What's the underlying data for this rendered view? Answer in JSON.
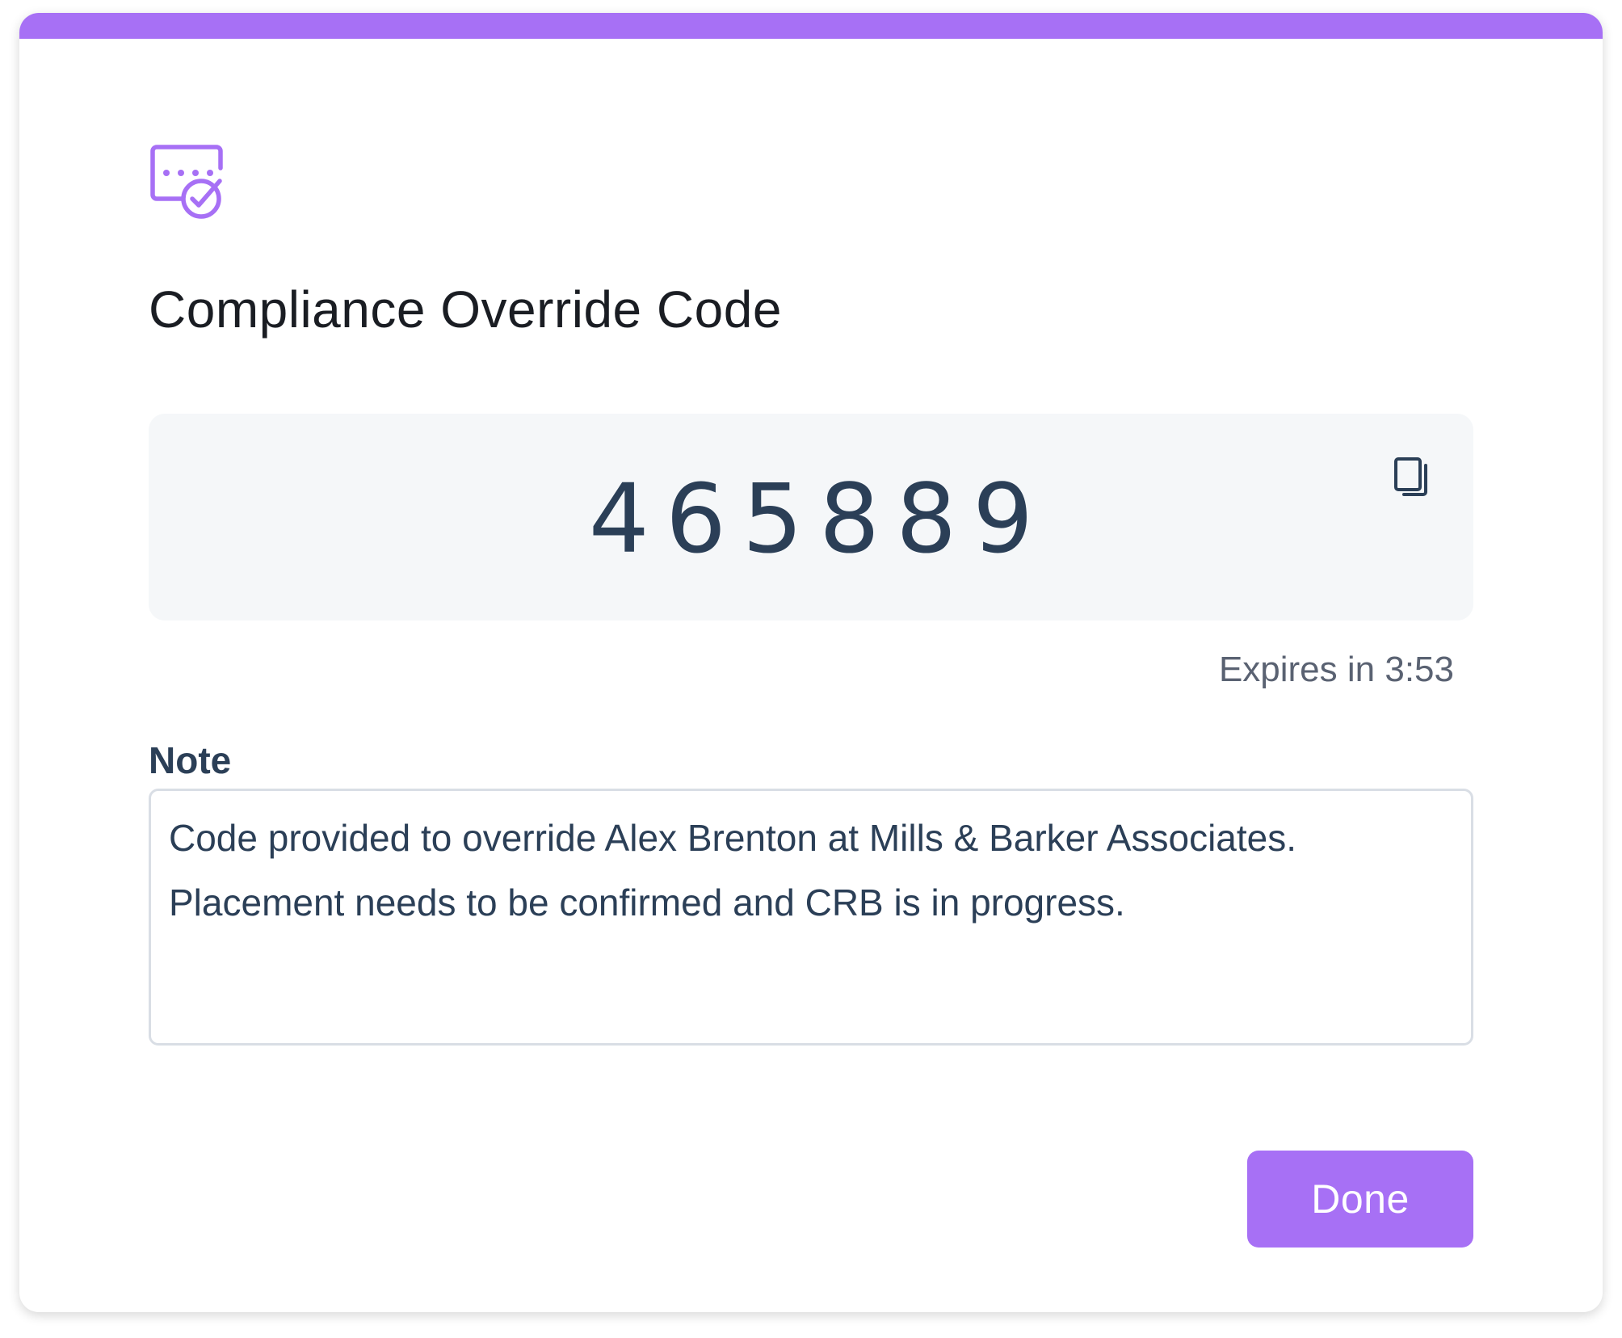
{
  "dialog": {
    "title": "Compliance Override Code",
    "header_icon": "code-verified-icon",
    "code": "465889",
    "copy_icon": "copy-icon",
    "expires_text": "Expires in 3:53",
    "note_label": "Note",
    "note_value": "Code provided to override Alex Brenton at Mills & Barker Associates. Placement needs to be confirmed and CRB is in progress.",
    "done_label": "Done"
  },
  "colors": {
    "accent": "#a770f5",
    "code_text": "#2b3f57",
    "code_box_bg": "#f5f7f9",
    "muted_text": "#5a6272"
  }
}
